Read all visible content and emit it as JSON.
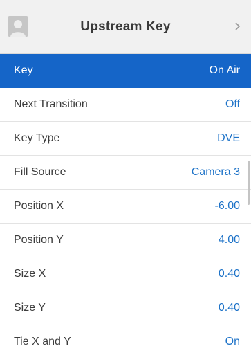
{
  "header": {
    "title": "Upstream Key",
    "icon": "camera-source-icon",
    "nav_icon": "chevron-right-icon"
  },
  "rows": [
    {
      "label": "Key",
      "value": "On Air",
      "selected": true
    },
    {
      "label": "Next Transition",
      "value": "Off"
    },
    {
      "label": "Key Type",
      "value": "DVE"
    },
    {
      "label": "Fill Source",
      "value": "Camera 3"
    },
    {
      "label": "Position X",
      "value": "-6.00"
    },
    {
      "label": "Position Y",
      "value": "4.00"
    },
    {
      "label": "Size X",
      "value": "0.40"
    },
    {
      "label": "Size Y",
      "value": "0.40"
    },
    {
      "label": "Tie X and Y",
      "value": "On"
    }
  ],
  "colors": {
    "accent": "#1565c8",
    "value_text": "#1e73c8",
    "header_bg": "#f1f1f1"
  }
}
